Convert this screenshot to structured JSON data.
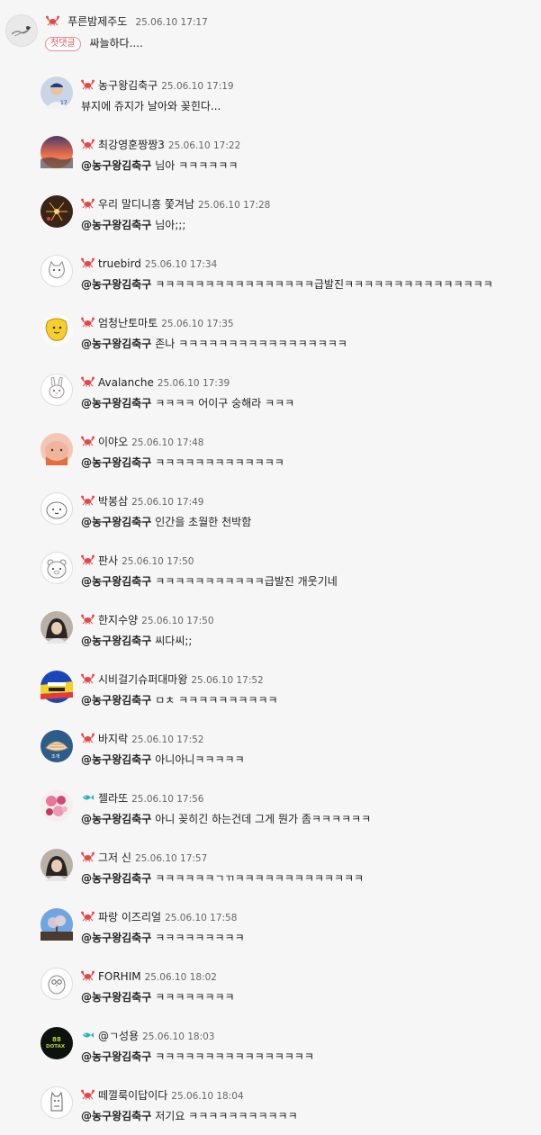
{
  "colors": {
    "background": "#f6f6f6",
    "badge_red": "#e0535b",
    "crab_red": "#e34848",
    "fish_teal": "#2bb3b3"
  },
  "top_comment": {
    "nickname": "푸른밤제주도",
    "time": "25.06.10 17:17",
    "badge": "첫댓글",
    "text": "싸늘하다....",
    "avatar_icon": "sketch-avatar-icon",
    "level_icon": "crab-icon"
  },
  "replies": [
    {
      "nickname": "농구왕김축구",
      "time": "25.06.10 17:19",
      "mention": "",
      "text": "뷰지에 쥬지가 날아와 꽂힌다...",
      "avatar_icon": "baseball-player-avatar-icon",
      "level_icon": "crab-icon"
    },
    {
      "nickname": "최강영훈짱짱3",
      "time": "25.06.10 17:22",
      "mention": "@농구왕김축구",
      "text": "님아 ㅋㅋㅋㅋㅋㅋ",
      "avatar_icon": "sunset-avatar-icon",
      "level_icon": "crab-icon"
    },
    {
      "nickname": "우리 말디니흥 쫓겨남",
      "time": "25.06.10 17:28",
      "mention": "@농구왕김축구",
      "text": "님아;;;",
      "avatar_icon": "fireworks-avatar-icon",
      "level_icon": "crab-icon"
    },
    {
      "nickname": "truebird",
      "time": "25.06.10 17:34",
      "mention": "@농구왕김축구",
      "text": "ㅋㅋㅋㅋㅋㅋㅋㅋㅋㅋㅋㅋㅋㅋㅋㅋ급발진ㅋㅋㅋㅋㅋㅋㅋㅋㅋㅋㅋㅋㅋㅋㅋ",
      "avatar_icon": "cat-doodle-avatar-icon",
      "level_icon": "crab-icon"
    },
    {
      "nickname": "엄청난토마토",
      "time": "25.06.10 17:35",
      "mention": "@농구왕김축구",
      "text": "존나 ㅋㅋㅋㅋㅋㅋㅋㅋㅋㅋㅋㅋㅋㅋㅋㅋㅋ",
      "avatar_icon": "yellow-character-avatar-icon",
      "level_icon": "crab-icon"
    },
    {
      "nickname": "Avalanche",
      "time": "25.06.10 17:39",
      "mention": "@농구왕김축구",
      "text": "ㅋㅋㅋㅋ 어이구 숭해라 ㅋㅋㅋ",
      "avatar_icon": "rabbit-doodle-avatar-icon",
      "level_icon": "crab-icon"
    },
    {
      "nickname": "이야오",
      "time": "25.06.10 17:48",
      "mention": "@농구왕김축구",
      "text": "ㅋㅋㅋㅋㅋㅋㅋㅋㅋㅋㅋㅋㅋ",
      "avatar_icon": "peach-character-avatar-icon",
      "level_icon": "crab-icon"
    },
    {
      "nickname": "박봉삼",
      "time": "25.06.10 17:49",
      "mention": "@농구왕김축구",
      "text": "인간을 초월한 천박함",
      "avatar_icon": "blob-doodle-avatar-icon",
      "level_icon": "crab-icon"
    },
    {
      "nickname": "판사",
      "time": "25.06.10 17:50",
      "mention": "@농구왕김축구",
      "text": "ㅋㅋㅋㅋㅋㅋㅋㅋㅋㅋㅋ급발진 개웃기네",
      "avatar_icon": "bear-doodle-avatar-icon",
      "level_icon": "crab-icon"
    },
    {
      "nickname": "한지수양",
      "time": "25.06.10 17:50",
      "mention": "@농구왕김축구",
      "text": "씨다씨;;",
      "avatar_icon": "person-photo-avatar-icon",
      "level_icon": "crab-icon"
    },
    {
      "nickname": "시비걸기슈퍼대마왕",
      "time": "25.06.10 17:52",
      "mention": "@농구왕김축구",
      "text": "ㅁㅊ ㅋㅋㅋㅋㅋㅋㅋㅋㅋㅋ",
      "avatar_icon": "colorful-logo-avatar-icon",
      "level_icon": "crab-icon"
    },
    {
      "nickname": "바지락",
      "time": "25.06.10 17:52",
      "mention": "@농구왕김축구",
      "text": "아니아니ㅋㅋㅋㅋㅋ",
      "avatar_icon": "clam-avatar-icon",
      "level_icon": "crab-icon"
    },
    {
      "nickname": "젤라또",
      "time": "25.06.10 17:56",
      "mention": "@농구왕김축구",
      "text": "아니 꽂히긴 하는건데 그게 뭔가 좀ㅋㅋㅋㅋㅋㅋ",
      "avatar_icon": "pink-flowers-avatar-icon",
      "level_icon": "fish-icon"
    },
    {
      "nickname": "그저 신",
      "time": "25.06.10 17:57",
      "mention": "@농구왕김축구",
      "text": "ㅋㅋㅋㅋㅋㅋㄱㄲㅋㅋㅋㅋㅋㅋㅋㅋㅋㅋㅋㅋㅋ",
      "avatar_icon": "person-photo-avatar-icon",
      "level_icon": "crab-icon"
    },
    {
      "nickname": "파랑 이즈리얼",
      "time": "25.06.10 17:58",
      "mention": "@농구왕김축구",
      "text": "ㅋㅋㅋㅋㅋㅋㅋㅋㅋ",
      "avatar_icon": "blue-sky-tree-avatar-icon",
      "level_icon": "crab-icon"
    },
    {
      "nickname": "FORHIM",
      "time": "25.06.10 18:02",
      "mention": "@농구왕김축구",
      "text": "ㅋㅋㅋㅋㅋㅋㅋㅋ",
      "avatar_icon": "owl-doodle-avatar-icon",
      "level_icon": "crab-icon"
    },
    {
      "nickname": "@ㄱ성용",
      "time": "25.06.10 18:03",
      "mention": "@농구왕김축구",
      "text": "ㅋㅋㅋㅋㅋㅋㅋㅋㅋㅋㅋㅋㅋㅋㅋㅋ",
      "avatar_icon": "dotax-logo-avatar-icon",
      "level_icon": "fish-icon"
    },
    {
      "nickname": "떼껄룩이답이다",
      "time": "25.06.10 18:04",
      "mention": "@농구왕김축구",
      "text": "저기요 ㅋㅋㅋㅋㅋㅋㅋㅋㅋㅋㅋ",
      "avatar_icon": "cat-outline-avatar-icon",
      "level_icon": "crab-icon"
    }
  ]
}
